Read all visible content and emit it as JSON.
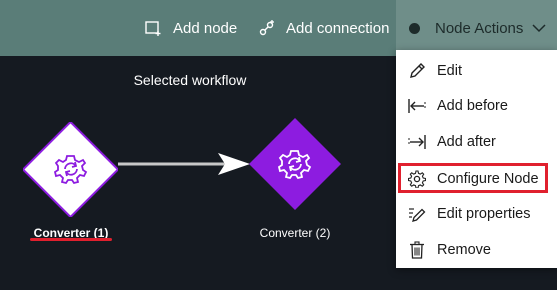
{
  "toolbar": {
    "add_node_label": "Add node",
    "add_connection_label": "Add connection",
    "node_actions_label": "Node Actions"
  },
  "canvas": {
    "title": "Selected workflow",
    "nodes": [
      {
        "label": "Converter (1)",
        "selected": true
      },
      {
        "label": "Converter (2)",
        "selected": false
      }
    ],
    "accent_color": "#8d1ce0"
  },
  "menu": {
    "items": [
      {
        "label": "Edit",
        "icon": "pencil-icon"
      },
      {
        "label": "Add before",
        "icon": "insert-before-icon"
      },
      {
        "label": "Add after",
        "icon": "insert-after-icon"
      },
      {
        "label": "Configure Node",
        "icon": "gear-icon"
      },
      {
        "label": "Edit properties",
        "icon": "edit-properties-icon"
      },
      {
        "label": "Remove",
        "icon": "trash-icon"
      }
    ],
    "highlighted": "Configure Node"
  },
  "annotation_color": "#e0202e"
}
